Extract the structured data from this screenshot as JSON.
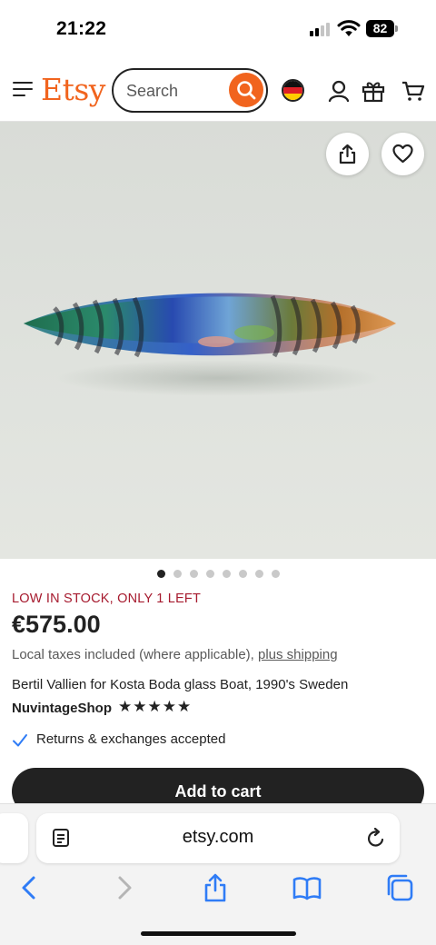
{
  "status_bar": {
    "time": "21:22",
    "battery": "82"
  },
  "header": {
    "logo": "Etsy",
    "search_placeholder": "Search",
    "icons": [
      "menu-icon",
      "search-icon",
      "germany-flag-icon",
      "account-icon",
      "gift-icon",
      "cart-icon"
    ]
  },
  "product_image": {
    "alt": "Bertil Vallien for Kosta Boda glass Boat, 1990's Sweden",
    "image_count": 8,
    "active_index": 0,
    "buttons": [
      "share-icon",
      "heart-icon"
    ]
  },
  "product": {
    "stock_notice": "LOW IN STOCK, ONLY 1 LEFT",
    "price": "€575.00",
    "tax_text": "Local taxes included (where applicable),",
    "shipping_link": "plus shipping",
    "title": "Bertil Vallien for Kosta Boda glass Boat, 1990's Sweden",
    "shop_name": "NuvintageShop",
    "rating_stars": "★★★★★",
    "rating": 5,
    "returns": "Returns & exchanges accepted",
    "add_to_cart": "Add to cart"
  },
  "browser": {
    "url": "etsy.com",
    "toolbar": [
      "back-icon",
      "forward-icon",
      "share-icon",
      "bookmarks-icon",
      "tabs-icon"
    ]
  },
  "colors": {
    "brand": "#f1641e",
    "stock_red": "#a61a2e",
    "ios_blue": "#2f7cf6",
    "dark": "#222222"
  }
}
